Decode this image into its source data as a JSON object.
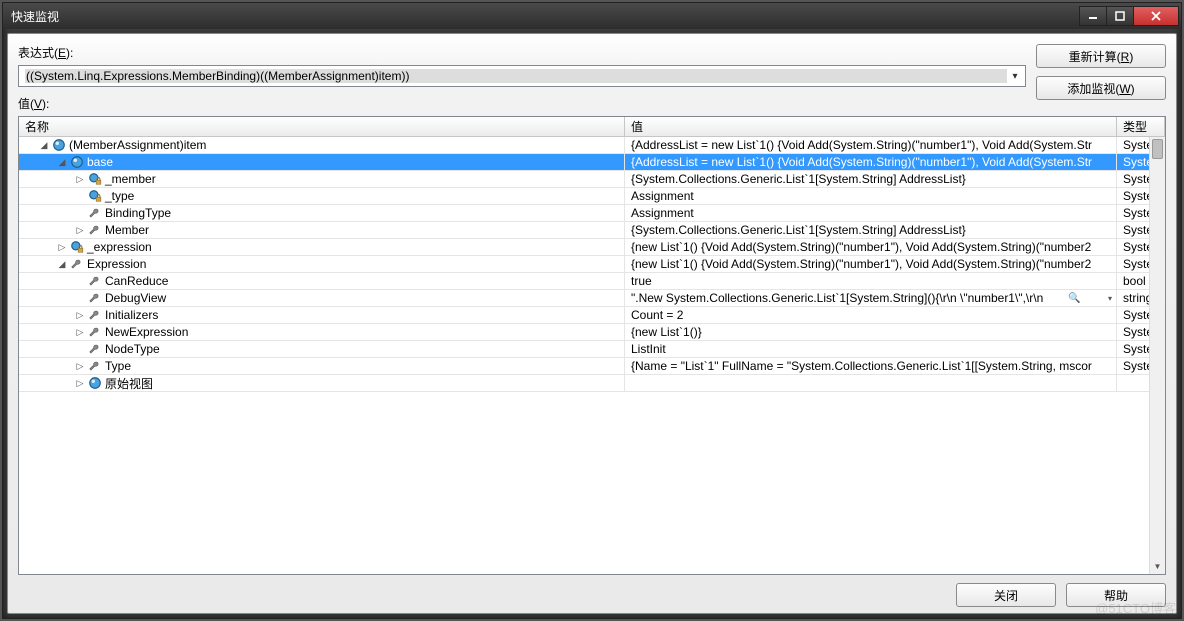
{
  "window": {
    "title": "快速监视"
  },
  "labels": {
    "expression": "表达式(E):",
    "value": "值(V):"
  },
  "buttons": {
    "reevaluate": "重新计算(R)",
    "addwatch": "添加监视(W)",
    "close": "关闭",
    "help": "帮助"
  },
  "expression": {
    "text": "((System.Linq.Expressions.MemberBinding)((MemberAssignment)item))"
  },
  "columns": {
    "name": "名称",
    "value": "值",
    "type": "类型"
  },
  "rows": [
    {
      "depth": 1,
      "expander": "open",
      "icon": "obj",
      "name": "(MemberAssignment)item",
      "value": "{AddressList = new List`1() {Void Add(System.String)(\"number1\"), Void Add(System.Str",
      "type": "System.L",
      "selected": false
    },
    {
      "depth": 2,
      "expander": "open",
      "icon": "obj",
      "name": "base",
      "value": "{AddressList = new List`1() {Void Add(System.String)(\"number1\"), Void Add(System.Str",
      "type": "System.L",
      "selected": true
    },
    {
      "depth": 3,
      "expander": "closed",
      "icon": "lock",
      "name": "_member",
      "value": "{System.Collections.Generic.List`1[System.String] AddressList}",
      "type": "System.R",
      "selected": false
    },
    {
      "depth": 3,
      "expander": "none",
      "icon": "lock",
      "name": "_type",
      "value": "Assignment",
      "type": "System.L",
      "selected": false
    },
    {
      "depth": 3,
      "expander": "none",
      "icon": "wrench",
      "name": "BindingType",
      "value": "Assignment",
      "type": "System.L",
      "selected": false
    },
    {
      "depth": 3,
      "expander": "closed",
      "icon": "wrench",
      "name": "Member",
      "value": "{System.Collections.Generic.List`1[System.String] AddressList}",
      "type": "System.R",
      "selected": false
    },
    {
      "depth": 2,
      "expander": "closed",
      "icon": "lock",
      "name": "_expression",
      "value": "{new List`1() {Void Add(System.String)(\"number1\"), Void Add(System.String)(\"number2",
      "type": "System.L",
      "selected": false
    },
    {
      "depth": 2,
      "expander": "open",
      "icon": "wrench",
      "name": "Expression",
      "value": "{new List`1() {Void Add(System.String)(\"number1\"), Void Add(System.String)(\"number2",
      "type": "System.L",
      "selected": false
    },
    {
      "depth": 3,
      "expander": "none",
      "icon": "wrench",
      "name": "CanReduce",
      "value": "true",
      "type": "bool",
      "selected": false
    },
    {
      "depth": 3,
      "expander": "none",
      "icon": "wrench",
      "name": "DebugView",
      "value": "\".New System.Collections.Generic.List`1[System.String](){\\r\\n    \\\"number1\\\",\\r\\n",
      "type": "string",
      "selected": false,
      "magnifier": true
    },
    {
      "depth": 3,
      "expander": "closed",
      "icon": "wrench",
      "name": "Initializers",
      "value": "Count = 2",
      "type": "System.C",
      "selected": false
    },
    {
      "depth": 3,
      "expander": "closed",
      "icon": "wrench",
      "name": "NewExpression",
      "value": "{new List`1()}",
      "type": "System.L",
      "selected": false
    },
    {
      "depth": 3,
      "expander": "none",
      "icon": "wrench",
      "name": "NodeType",
      "value": "ListInit",
      "type": "System.L",
      "selected": false
    },
    {
      "depth": 3,
      "expander": "closed",
      "icon": "wrench",
      "name": "Type",
      "value": "{Name = \"List`1\" FullName = \"System.Collections.Generic.List`1[[System.String, mscor",
      "type": "System.T",
      "selected": false
    },
    {
      "depth": 3,
      "expander": "closed",
      "icon": "obj",
      "name": "原始视图",
      "value": "",
      "type": "",
      "selected": false
    }
  ],
  "watermark": "@51CTO博客"
}
